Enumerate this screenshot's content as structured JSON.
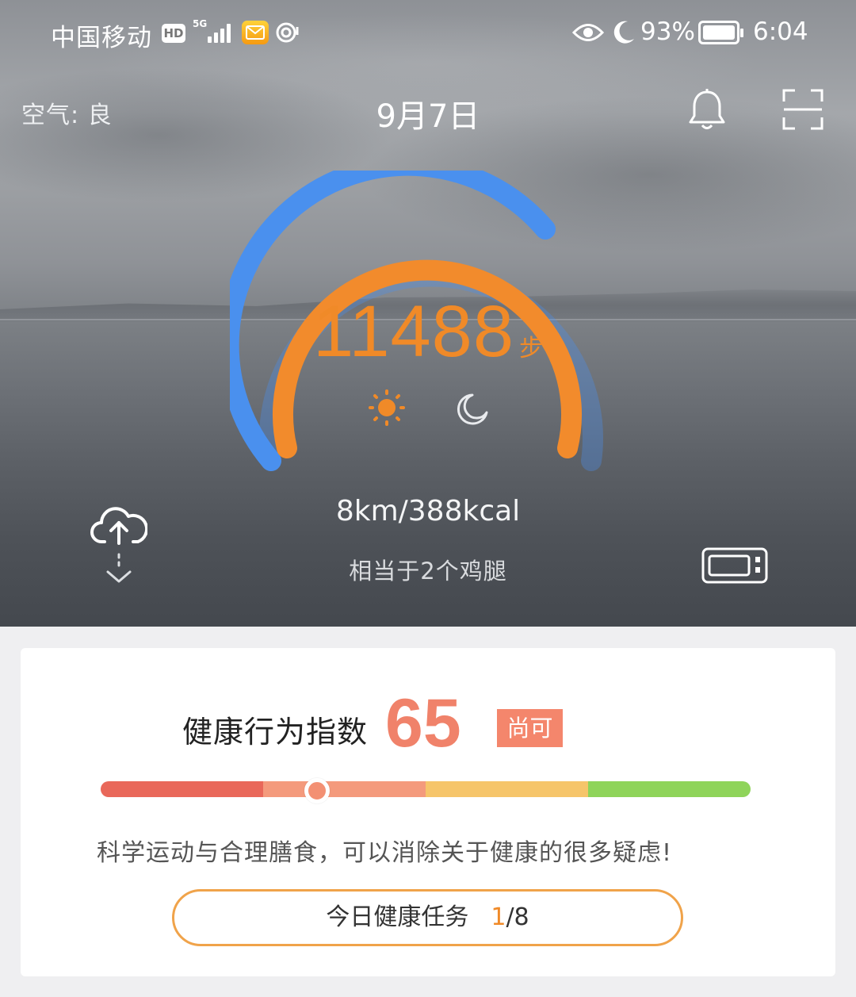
{
  "status_bar": {
    "carrier": "中国移动",
    "hd": "HD",
    "network": "5G",
    "battery_pct": "93%",
    "time": "6:04",
    "icons": [
      "mail-icon",
      "nfc-icon",
      "eye-icon",
      "moon-icon",
      "battery-icon"
    ]
  },
  "header": {
    "air_quality": "空气: 良",
    "date": "9月7日",
    "icons": [
      "bell-icon",
      "scan-icon"
    ]
  },
  "activity": {
    "steps": "11488",
    "steps_unit": "步",
    "distance_kcal": "8km/388kcal",
    "equivalent": "相当于2个鸡腿",
    "icons": [
      "sun-icon",
      "moon-icon",
      "cloud-upload-icon",
      "device-icon"
    ],
    "colors": {
      "steps_accent": "#f08a28",
      "gauge_outer": "#4a90ee",
      "gauge_inner": "#f28b2c"
    }
  },
  "health_index": {
    "label": "健康行为指数",
    "score": "65",
    "rating": "尚可",
    "colors": [
      "#e9685a",
      "#f49a7c",
      "#f6c56a",
      "#8fd45a"
    ],
    "tip": "科学运动与合理膳食，可以消除关于健康的很多疑虑!",
    "task_label": "今日健康任务",
    "task_done": "1",
    "task_total": "/8"
  }
}
